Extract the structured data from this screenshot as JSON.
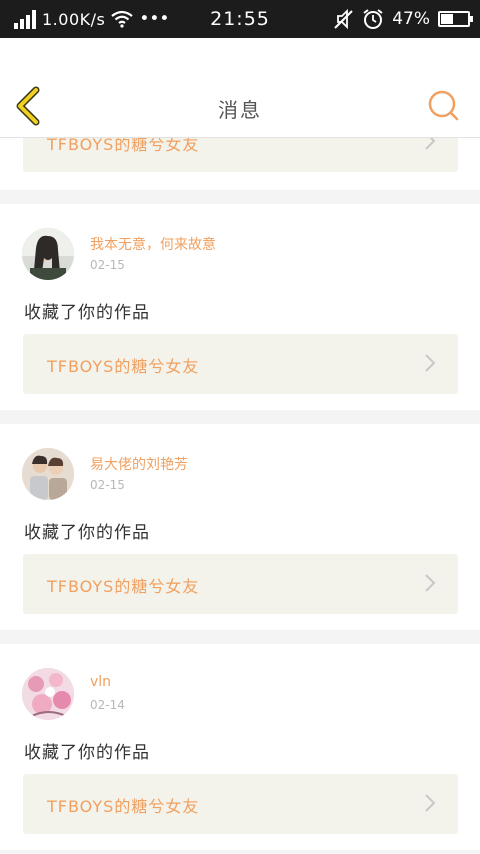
{
  "status_bar": {
    "speed": "1.00K/s",
    "dots": "•••",
    "time": "21:55",
    "battery": "47%",
    "battery_level": 0.47
  },
  "header": {
    "title": "消息"
  },
  "partial": {
    "work_title": "TFBOYS的糖兮女友"
  },
  "messages": [
    {
      "username": "我本无意，何来故意",
      "date": "02-15",
      "action": "收藏了你的作品",
      "work_title": "TFBOYS的糖兮女友"
    },
    {
      "username": "易大佬的刘艳芳",
      "date": "02-15",
      "action": "收藏了你的作品",
      "work_title": "TFBOYS的糖兮女友"
    },
    {
      "username": "vln",
      "date": "02-14",
      "action": "收藏了你的作品",
      "work_title": "TFBOYS的糖兮女友"
    }
  ],
  "colors": {
    "accent": "#f0a060",
    "back_icon": "#f2d020",
    "status_bg": "#1c1c1c",
    "link_bg": "#f3f3ec"
  }
}
